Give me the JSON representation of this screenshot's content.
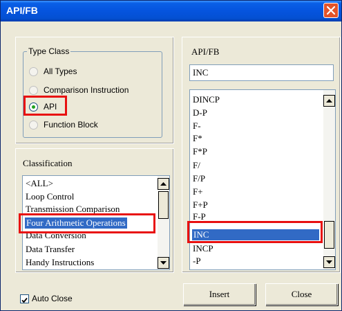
{
  "window": {
    "title": "API/FB"
  },
  "type_class": {
    "legend": "Type Class",
    "options": [
      {
        "label": "All Types",
        "selected": false
      },
      {
        "label": "Comparison Instruction",
        "selected": false
      },
      {
        "label": "API",
        "selected": true
      },
      {
        "label": "Function Block",
        "selected": false
      }
    ]
  },
  "classification": {
    "label": "Classification",
    "items": [
      "<ALL>",
      "Loop Control",
      "Transmission Comparison",
      "Four Arithmetic Operations",
      "Data Conversion",
      "Data Transfer",
      "Handy Instructions"
    ],
    "selected_index": 3
  },
  "api_fb": {
    "label": "API/FB",
    "input_value": "INC",
    "items": [
      "DINCP",
      "D-P",
      "F-",
      "F*",
      "F*P",
      "F/",
      "F/P",
      "F+",
      "F+P",
      "F-P",
      "INC",
      "INCP",
      "-P"
    ],
    "selected_index": 10
  },
  "auto_close": {
    "label": "Auto Close",
    "checked": true
  },
  "buttons": {
    "insert": "Insert",
    "close": "Close"
  },
  "colors": {
    "selection": "#316ac5",
    "highlight_box": "#e81010",
    "title_bar": "#0554de"
  }
}
